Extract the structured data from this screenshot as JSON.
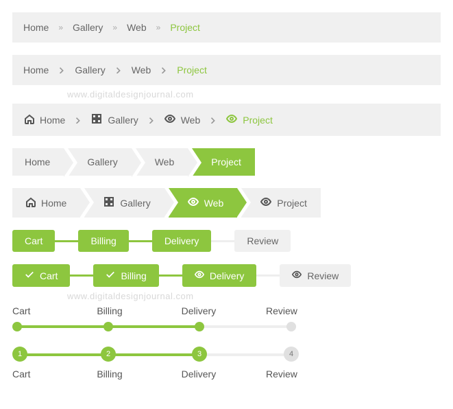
{
  "breadcrumb": {
    "items": [
      {
        "label": "Home",
        "icon": "home-icon"
      },
      {
        "label": "Gallery",
        "icon": "grid-icon"
      },
      {
        "label": "Web",
        "icon": "eye-icon"
      },
      {
        "label": "Project",
        "icon": "eye-icon"
      }
    ],
    "current_index": 3,
    "separators": {
      "raquo": "»",
      "chevron": ">"
    }
  },
  "arrow_nav_active_index": 3,
  "arrow_icon_nav_active_index": 2,
  "steps": {
    "items": [
      {
        "label": "Cart",
        "state": "done",
        "icon": "check-icon"
      },
      {
        "label": "Billing",
        "state": "done",
        "icon": "check-icon"
      },
      {
        "label": "Delivery",
        "state": "current",
        "icon": "eye-icon"
      },
      {
        "label": "Review",
        "state": "future",
        "icon": "eye-icon"
      }
    ],
    "progress_index": 2
  },
  "watermark": "www.digitaldesignjournal.com",
  "colors": {
    "accent": "#8dc63f",
    "muted_bg": "#f0f0f0",
    "text": "#666666"
  }
}
